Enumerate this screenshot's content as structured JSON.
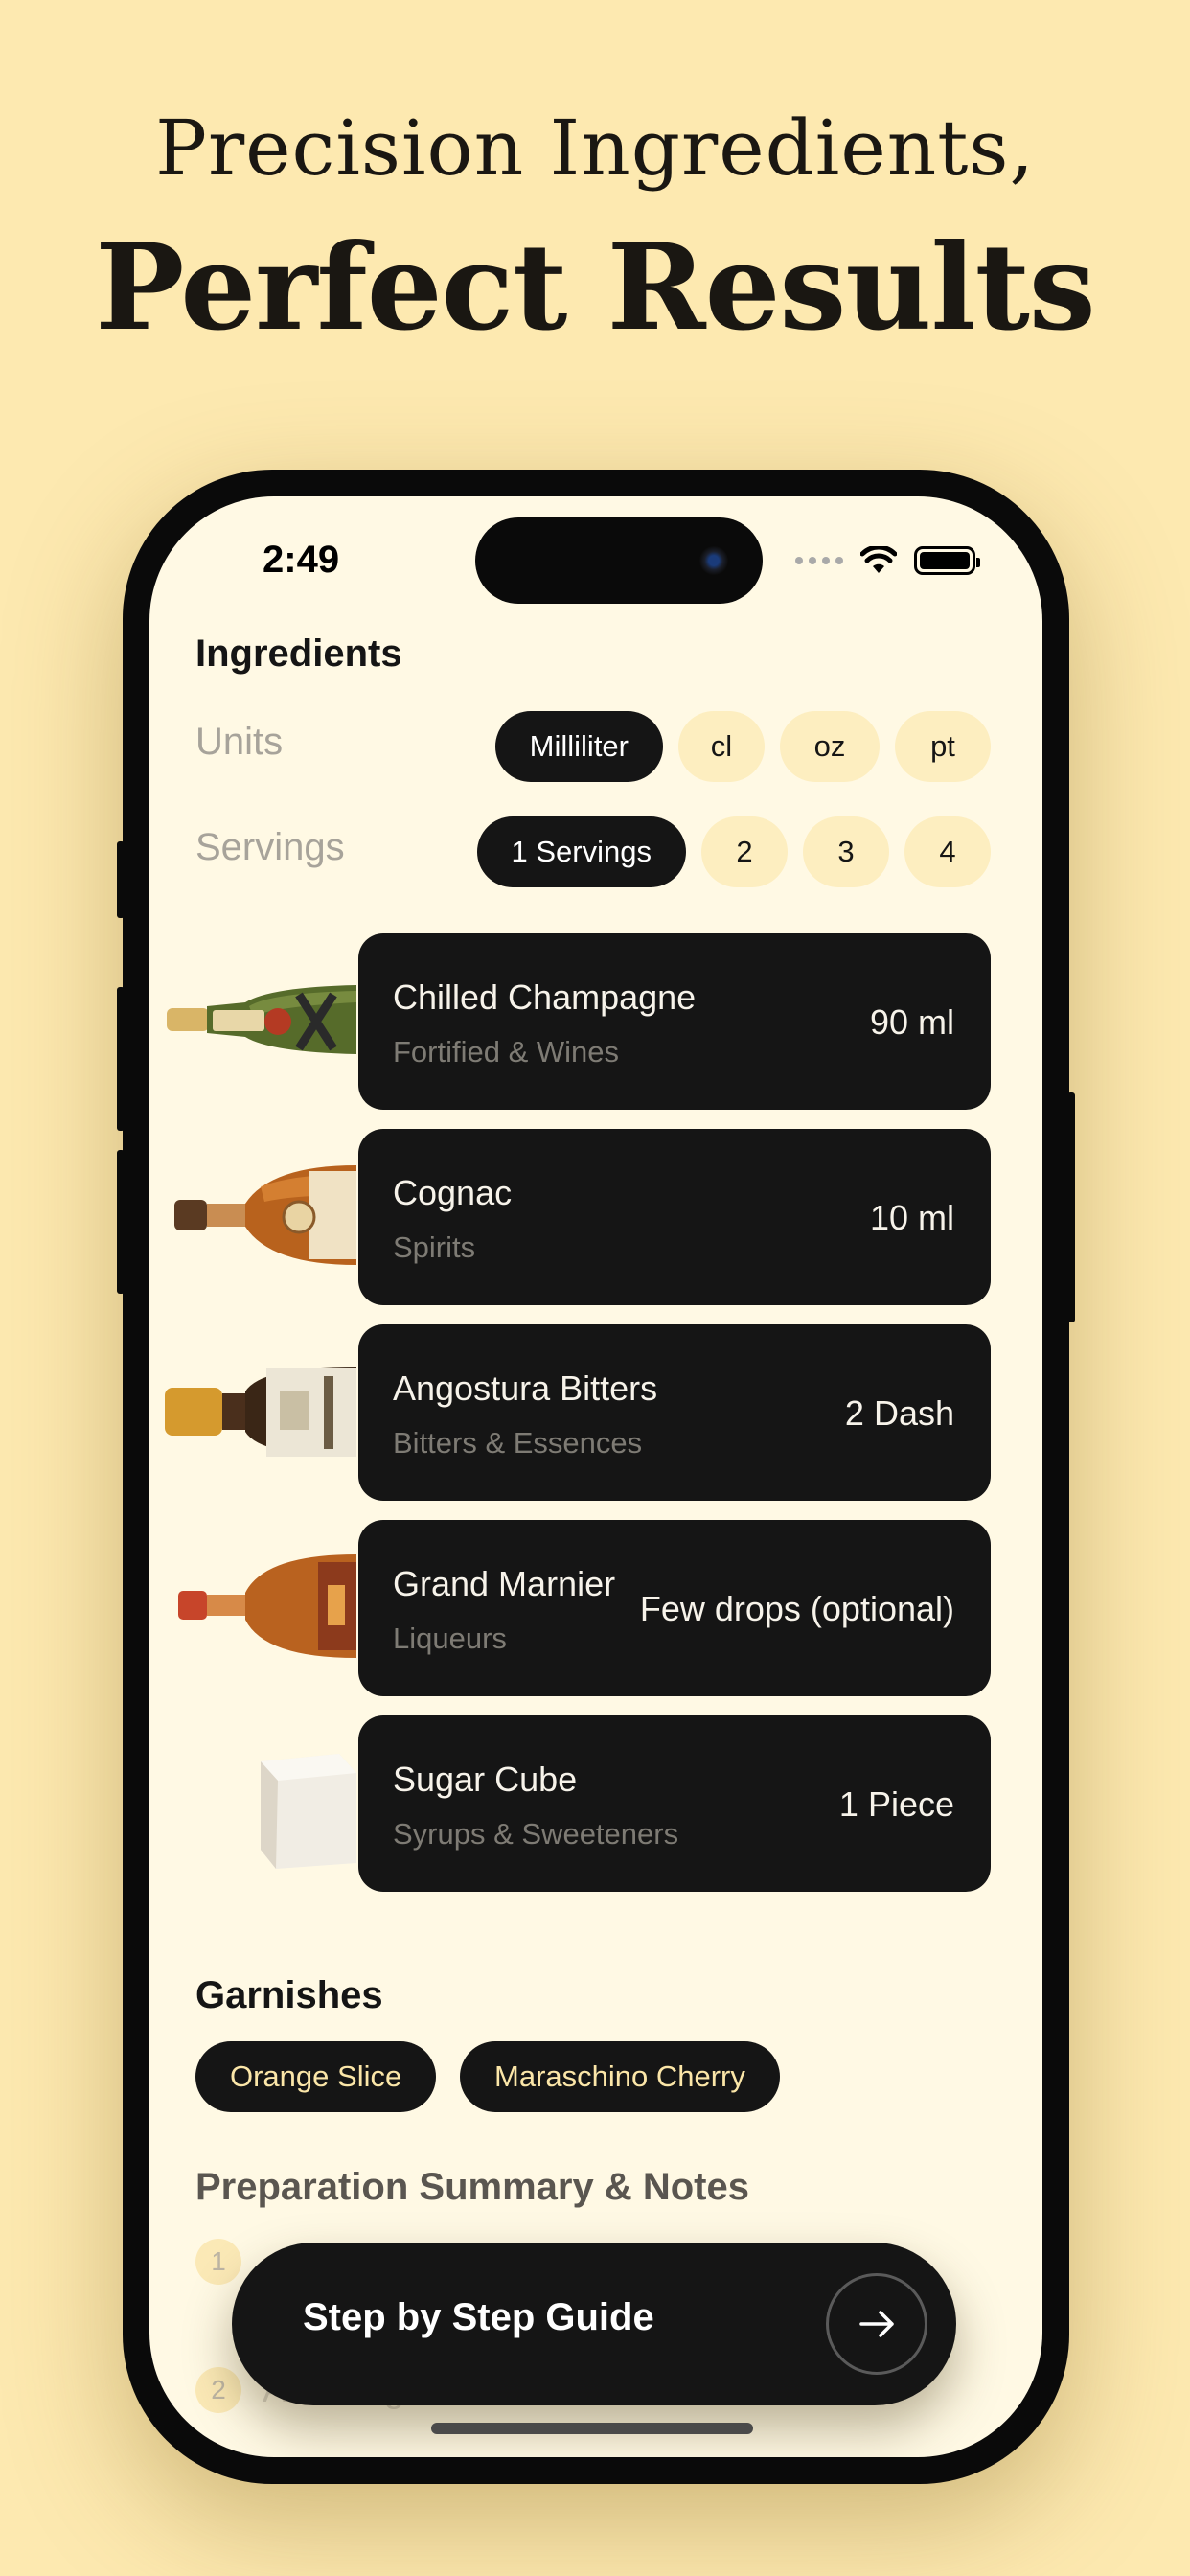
{
  "headline": {
    "line1": "Precision Ingredients,",
    "line2": "Perfect Results"
  },
  "status_bar": {
    "time": "2:49"
  },
  "ingredients_section": {
    "title": "Ingredients",
    "units_label": "Units",
    "units_options": [
      "Milliliter",
      "cl",
      "oz",
      "pt"
    ],
    "units_selected": "Milliliter",
    "servings_label": "Servings",
    "servings_options": [
      "1 Servings",
      "2",
      "3",
      "4"
    ],
    "servings_selected": "1 Servings",
    "items": [
      {
        "name": "Chilled Champagne",
        "category": "Fortified & Wines",
        "amount": "90 ml",
        "icon": "champagne-bottle-icon"
      },
      {
        "name": "Cognac",
        "category": "Spirits",
        "amount": "10 ml",
        "icon": "cognac-bottle-icon"
      },
      {
        "name": "Angostura Bitters",
        "category": "Bitters & Essences",
        "amount": "2 Dash",
        "icon": "bitters-bottle-icon"
      },
      {
        "name": "Grand Marnier",
        "category": "Liqueurs",
        "amount": "Few drops (optional)",
        "icon": "liqueur-bottle-icon"
      },
      {
        "name": "Sugar Cube",
        "category": "Syrups & Sweeteners",
        "amount": "1 Piece",
        "icon": "sugar-cube-icon"
      }
    ]
  },
  "garnishes_section": {
    "title": "Garnishes",
    "items": [
      "Orange Slice",
      "Maraschino Cherry"
    ]
  },
  "preparation_section": {
    "title": "Preparation Summary & Notes",
    "steps": [
      {
        "number": "1",
        "text": ""
      },
      {
        "number": "2",
        "text": "Add Cognac."
      }
    ]
  },
  "guide_button": {
    "label": "Step by Step Guide",
    "icon": "arrow-right-icon"
  },
  "colors": {
    "background": "#fde9b0",
    "screen": "#fff9e4",
    "card": "#151515",
    "chip_inactive": "#fdeec0",
    "garnish_text": "#fbe6a8"
  }
}
